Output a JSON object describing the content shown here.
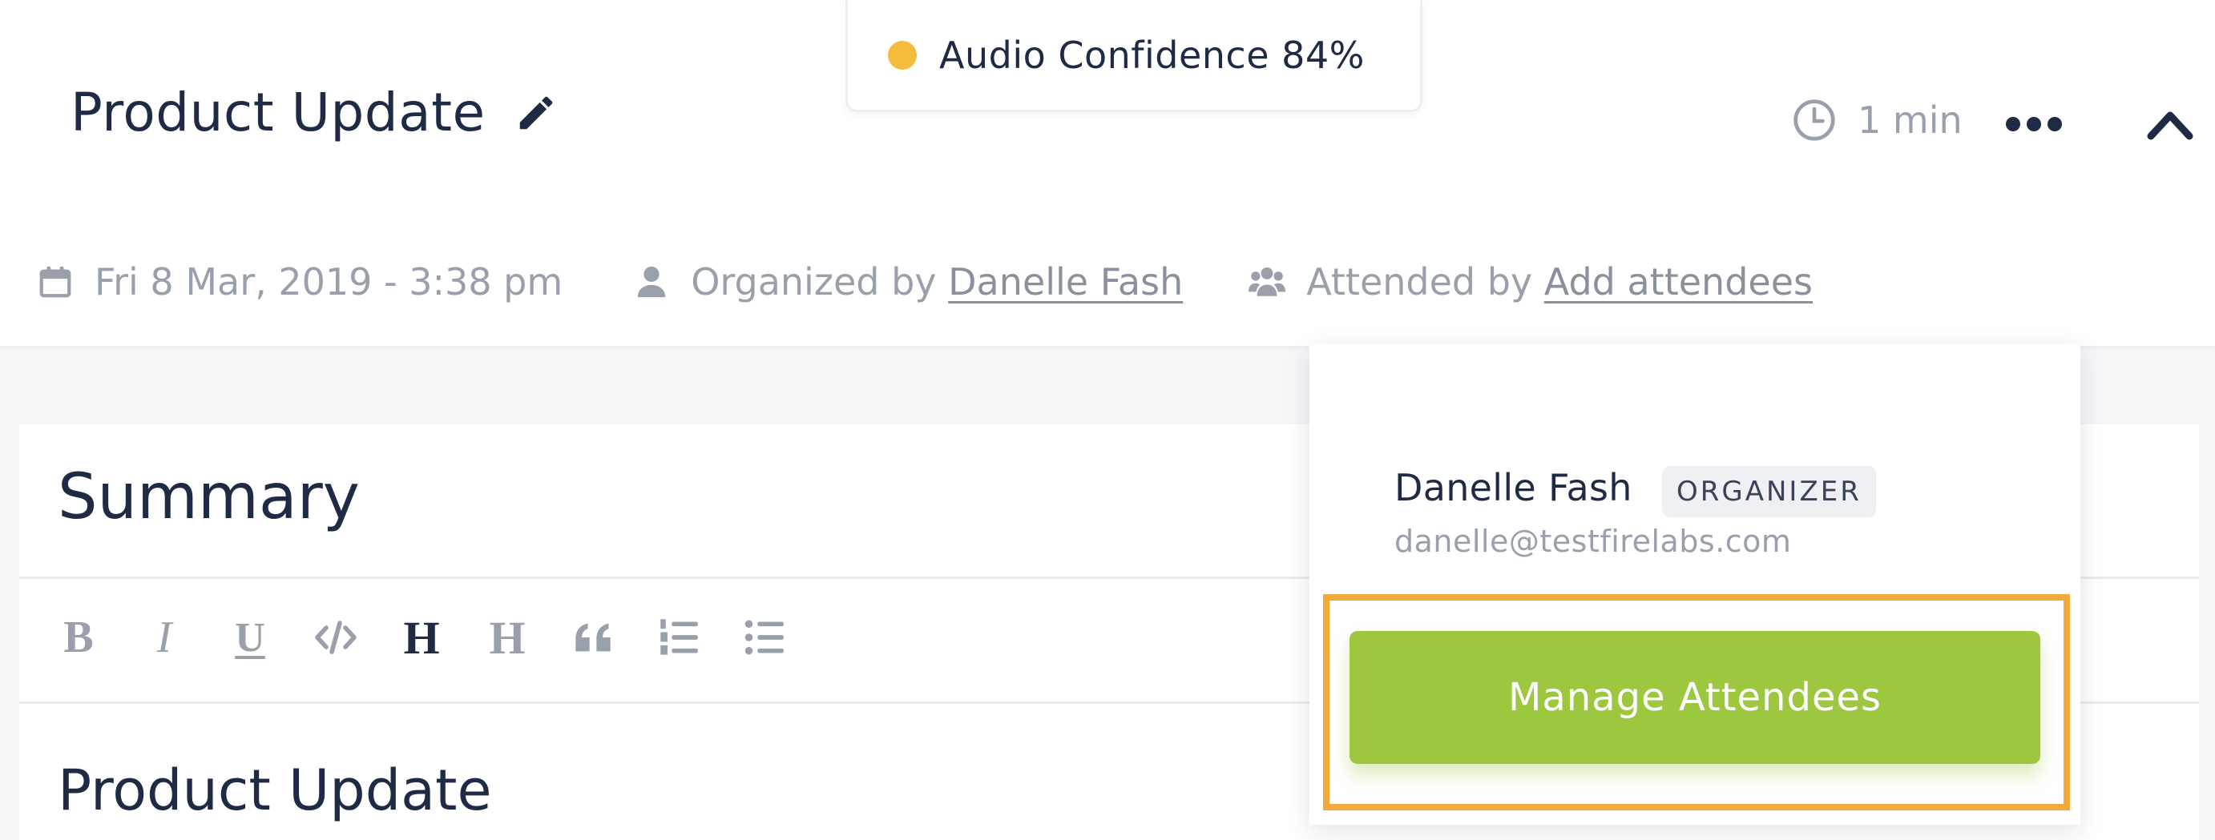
{
  "meeting": {
    "title": "Product Update",
    "duration": "1 min",
    "date": "Fri 8 Mar, 2019 - 3:38 pm",
    "organized_prefix": "Organized by",
    "organizer_name": "Danelle Fash",
    "attended_prefix": "Attended by",
    "add_attendees_link": "Add attendees"
  },
  "audio_confidence": {
    "label": "Audio Confidence 84%",
    "value_percent": 84,
    "dot_color": "#f5bb3c"
  },
  "summary": {
    "title": "Summary",
    "toolbar": {
      "bold": "B",
      "italic": "I",
      "underline": "U",
      "heading_primary": "H",
      "heading_secondary": "H",
      "active_tool": "heading_primary"
    },
    "content_heading": "Product Update"
  },
  "attendees_popover": {
    "attendee": {
      "name": "Danelle Fash",
      "role_badge": "ORGANIZER",
      "email": "danelle@testfirelabs.com"
    },
    "manage_button": "Manage Attendees"
  },
  "icons": {
    "edit": "pencil-icon",
    "duration": "clock-icon",
    "more": "more-horizontal-icon",
    "collapse": "chevron-up-icon",
    "date": "calendar-icon",
    "organizer": "person-icon",
    "attendees": "people-group-icon",
    "code": "code-icon",
    "quote": "quote-icon",
    "ordered_list": "ordered-list-icon",
    "bullet_list": "bullet-list-icon"
  },
  "colors": {
    "text_primary": "#1f2a44",
    "text_muted": "#9aa0ab",
    "confidence_dot": "#f5bb3c",
    "manage_button_bg": "#9dc73f",
    "highlight_border": "#f2a93b"
  }
}
